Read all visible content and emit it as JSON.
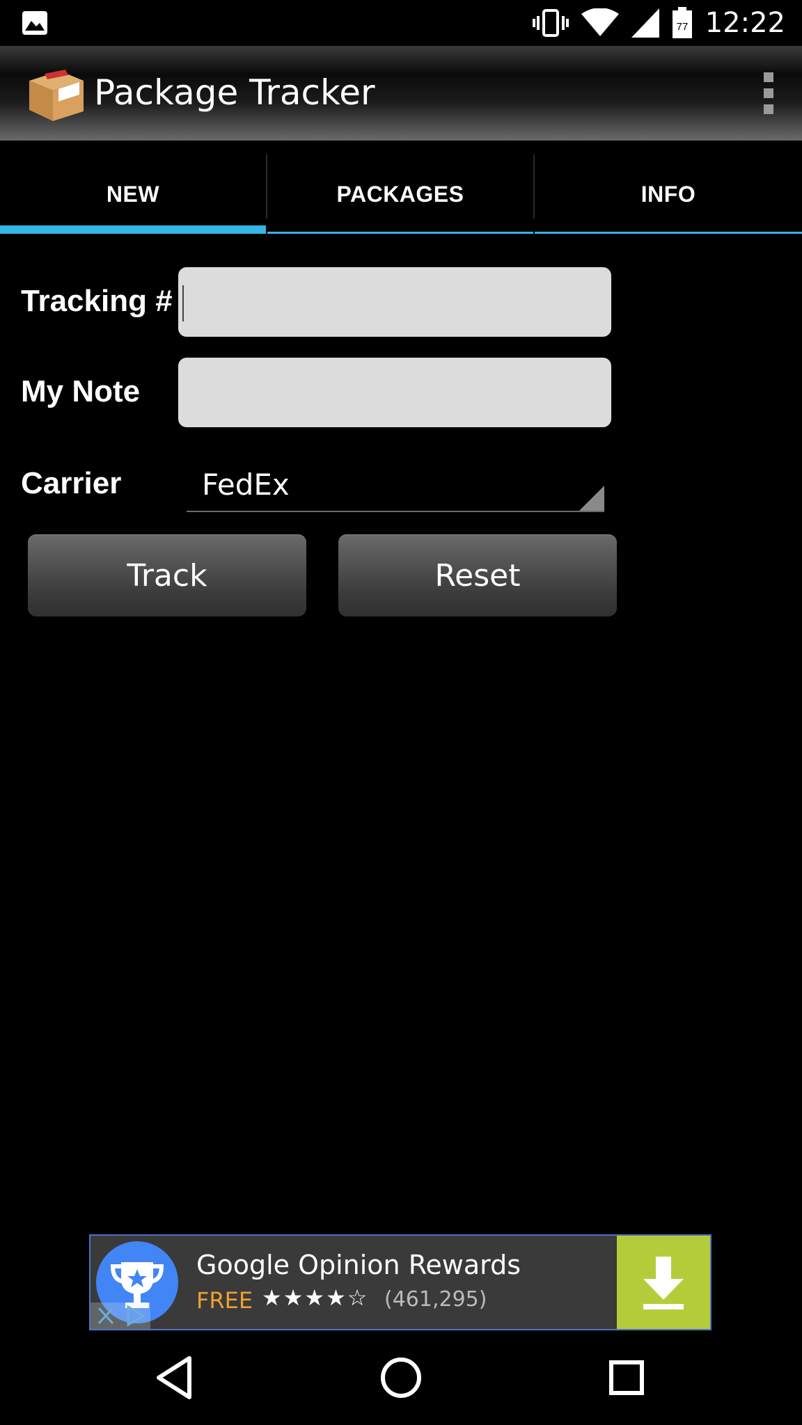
{
  "status_bar": {
    "time": "12:22",
    "battery_level": "77",
    "icons": [
      "image-notification-icon",
      "vibrate-icon",
      "wifi-icon",
      "signal-icon",
      "battery-icon"
    ]
  },
  "action_bar": {
    "title": "Package Tracker",
    "icon": "package-box-icon",
    "overflow_icon": "overflow-menu-icon"
  },
  "tabs": [
    {
      "label": "NEW",
      "active": true
    },
    {
      "label": "PACKAGES",
      "active": false
    },
    {
      "label": "INFO",
      "active": false
    }
  ],
  "form": {
    "tracking_label": "Tracking #",
    "tracking_value": "",
    "note_label": "My Note",
    "note_value": "",
    "carrier_label": "Carrier",
    "carrier_value": "FedEx",
    "track_button": "Track",
    "reset_button": "Reset"
  },
  "ad": {
    "title": "Google Opinion Rewards",
    "price": "FREE",
    "stars": "★★★★☆",
    "rating_count": "(461,295)",
    "icon": "trophy-icon",
    "action_icon": "download-icon"
  },
  "colors": {
    "accent": "#33b5e5",
    "input_bg": "#dcdcdc",
    "ad_green": "#b5cc3a",
    "ad_free": "#f0a030"
  },
  "nav_bar": {
    "icons": [
      "back-icon",
      "home-icon",
      "recents-icon"
    ]
  }
}
